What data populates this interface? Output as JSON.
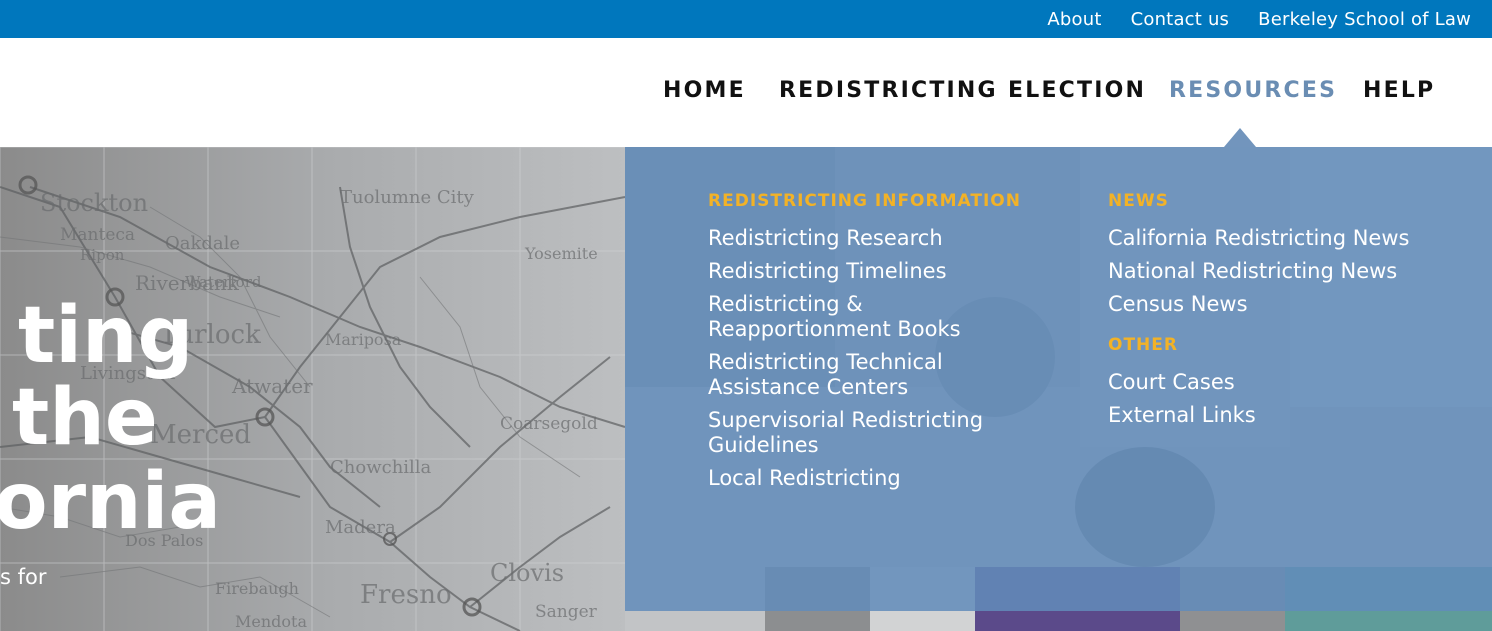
{
  "topbar": {
    "links": [
      "About",
      "Contact us",
      "Berkeley School of Law"
    ]
  },
  "nav": {
    "items": [
      "HOME",
      "REDISTRICTING",
      "ELECTION",
      "RESOURCES",
      "HELP"
    ],
    "active": "RESOURCES"
  },
  "hero": {
    "line1": "ting",
    "line2": "the",
    "line3": "ornia",
    "sub": "s for",
    "map_labels": [
      "Stockton",
      "Manteca",
      "Ripon",
      "Oakdale",
      "Riverbank",
      "Waterford",
      "Turlock",
      "Tuolumne City",
      "Mariposa",
      "Atwater",
      "Livingston",
      "Merced",
      "Chowchilla",
      "Coarsegold",
      "Madera",
      "Dos Palos",
      "Firebaugh",
      "Fresno",
      "Clovis",
      "Mendota",
      "Sanger",
      "Yosemite"
    ]
  },
  "dropdown": {
    "left": {
      "heading": "REDISTRICTING INFORMATION",
      "links": [
        "Redistricting Research",
        "Redistricting Timelines",
        "Redistricting & Reapportionment Books",
        "Redistricting Technical Assistance Centers",
        "Supervisorial Redistricting Guidelines",
        "Local Redistricting"
      ]
    },
    "right": {
      "news_heading": "NEWS",
      "news_links": [
        "California Redistricting News",
        "National Redistricting News",
        "Census News"
      ],
      "other_heading": "OTHER",
      "other_links": [
        "Court Cases",
        "External Links"
      ]
    }
  },
  "colors": {
    "topbar": "#0077bd",
    "nav_active": "#6a8db3",
    "dropdown_bg": "#628cba",
    "dropdown_heading": "#f2b227"
  }
}
